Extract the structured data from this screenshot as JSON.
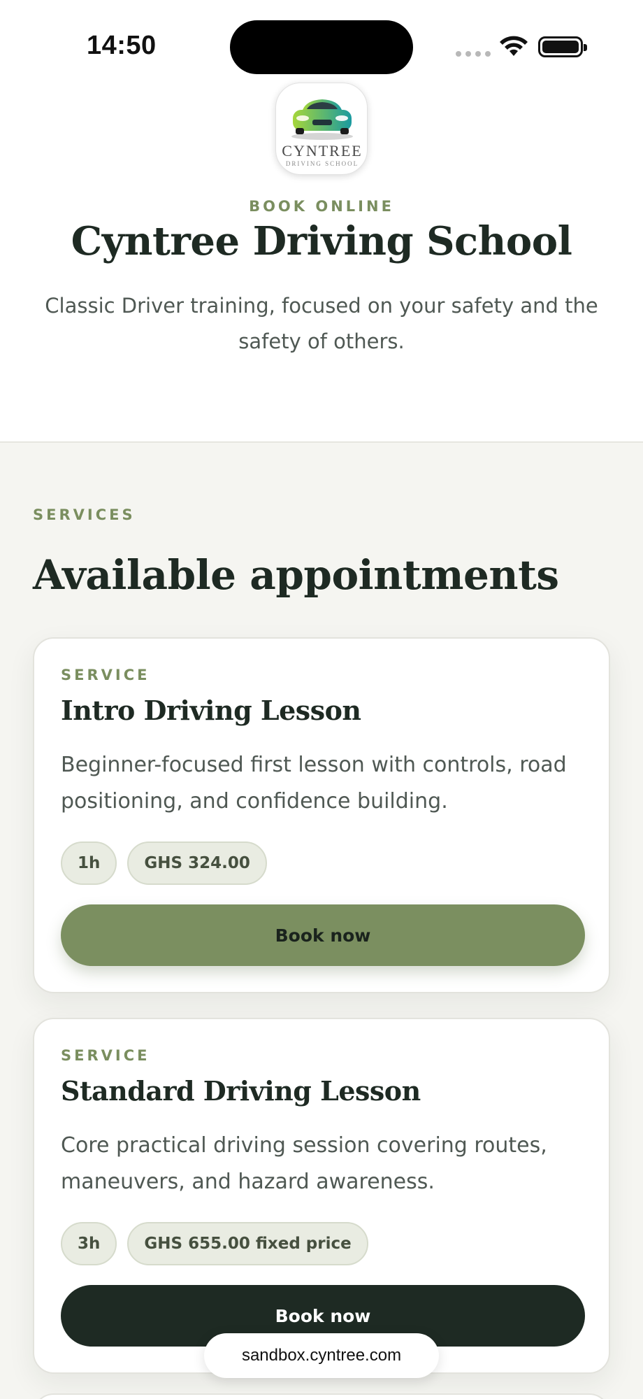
{
  "status_bar": {
    "time": "14:50"
  },
  "hero": {
    "logo_text": "CYNTREE",
    "logo_subtext": "DRIVING SCHOOL",
    "eyebrow": "BOOK ONLINE",
    "title": "Cyntree Driving School",
    "description": "Classic Driver training, focused on your safety and the safety of others."
  },
  "services": {
    "eyebrow": "SERVICES",
    "title": "Available appointments",
    "items": [
      {
        "eyebrow": "SERVICE",
        "title": "Intro Driving Lesson",
        "description": "Beginner-focused first lesson with controls, road positioning, and confidence building.",
        "duration": "1h",
        "price": "GHS 324.00",
        "cta": "Book now"
      },
      {
        "eyebrow": "SERVICE",
        "title": "Standard Driving Lesson",
        "description": "Core practical driving session covering routes, maneuvers, and hazard awareness.",
        "duration": "3h",
        "price": "GHS 655.00 fixed price",
        "cta": "Book now"
      }
    ]
  },
  "browser": {
    "url": "sandbox.cyntree.com"
  },
  "colors": {
    "accent_green": "#7b8f60",
    "dark": "#1e2a23",
    "eyebrow": "#7a8e5f",
    "background": "#f5f5f1"
  }
}
